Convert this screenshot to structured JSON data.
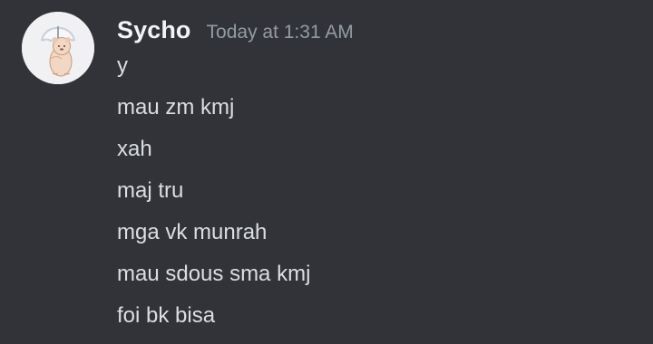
{
  "message": {
    "avatar_icon": "user-avatar-bear-umbrella",
    "username": "Sycho",
    "timestamp": "Today at 1:31 AM",
    "lines": [
      "y",
      "mau zm kmj",
      "xah",
      "maj tru",
      "mga vk munrah",
      "mau sdous sma kmj",
      "foi bk bisa"
    ]
  },
  "colors": {
    "background": "#313338",
    "username": "#f2f3f5",
    "timestamp": "#949ba4",
    "message_text": "#dbdee1"
  }
}
